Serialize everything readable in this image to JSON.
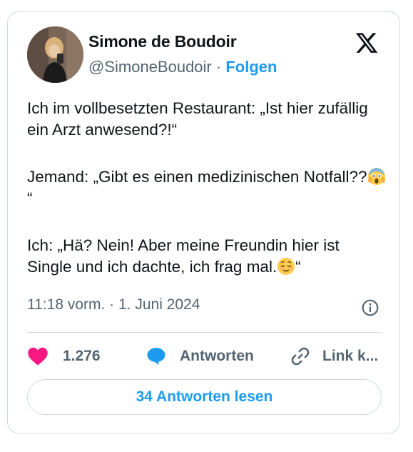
{
  "author": {
    "name": "Simone de Boudoir",
    "handle": "@SimoneBoudoir",
    "separator": "·",
    "follow_label": "Folgen"
  },
  "tweet": {
    "paragraphs": [
      "Ich im vollbesetzten Restaurant: „Ist hier zufällig ein Arzt anwesend?!“",
      "Jemand: „Gibt es einen medizinischen Notfall??",
      "Ich: „Hä? Nein! Aber meine Freundin hier ist Single und ich dachte, ich frag mal."
    ],
    "closing_quote": "“",
    "emojis": [
      "face-screaming-in-fear",
      "relieved-face"
    ],
    "timestamp": "11:18 vorm. · 1. Juni 2024"
  },
  "actions": {
    "like_count": "1.276",
    "reply_label": "Antworten",
    "link_label": "Link k..."
  },
  "read_replies_label": "34 Antworten lesen",
  "colors": {
    "accent": "#1d9bf0",
    "like": "#f91880",
    "text": "#0f1419",
    "secondary": "#536471",
    "border": "#cfd9de"
  }
}
